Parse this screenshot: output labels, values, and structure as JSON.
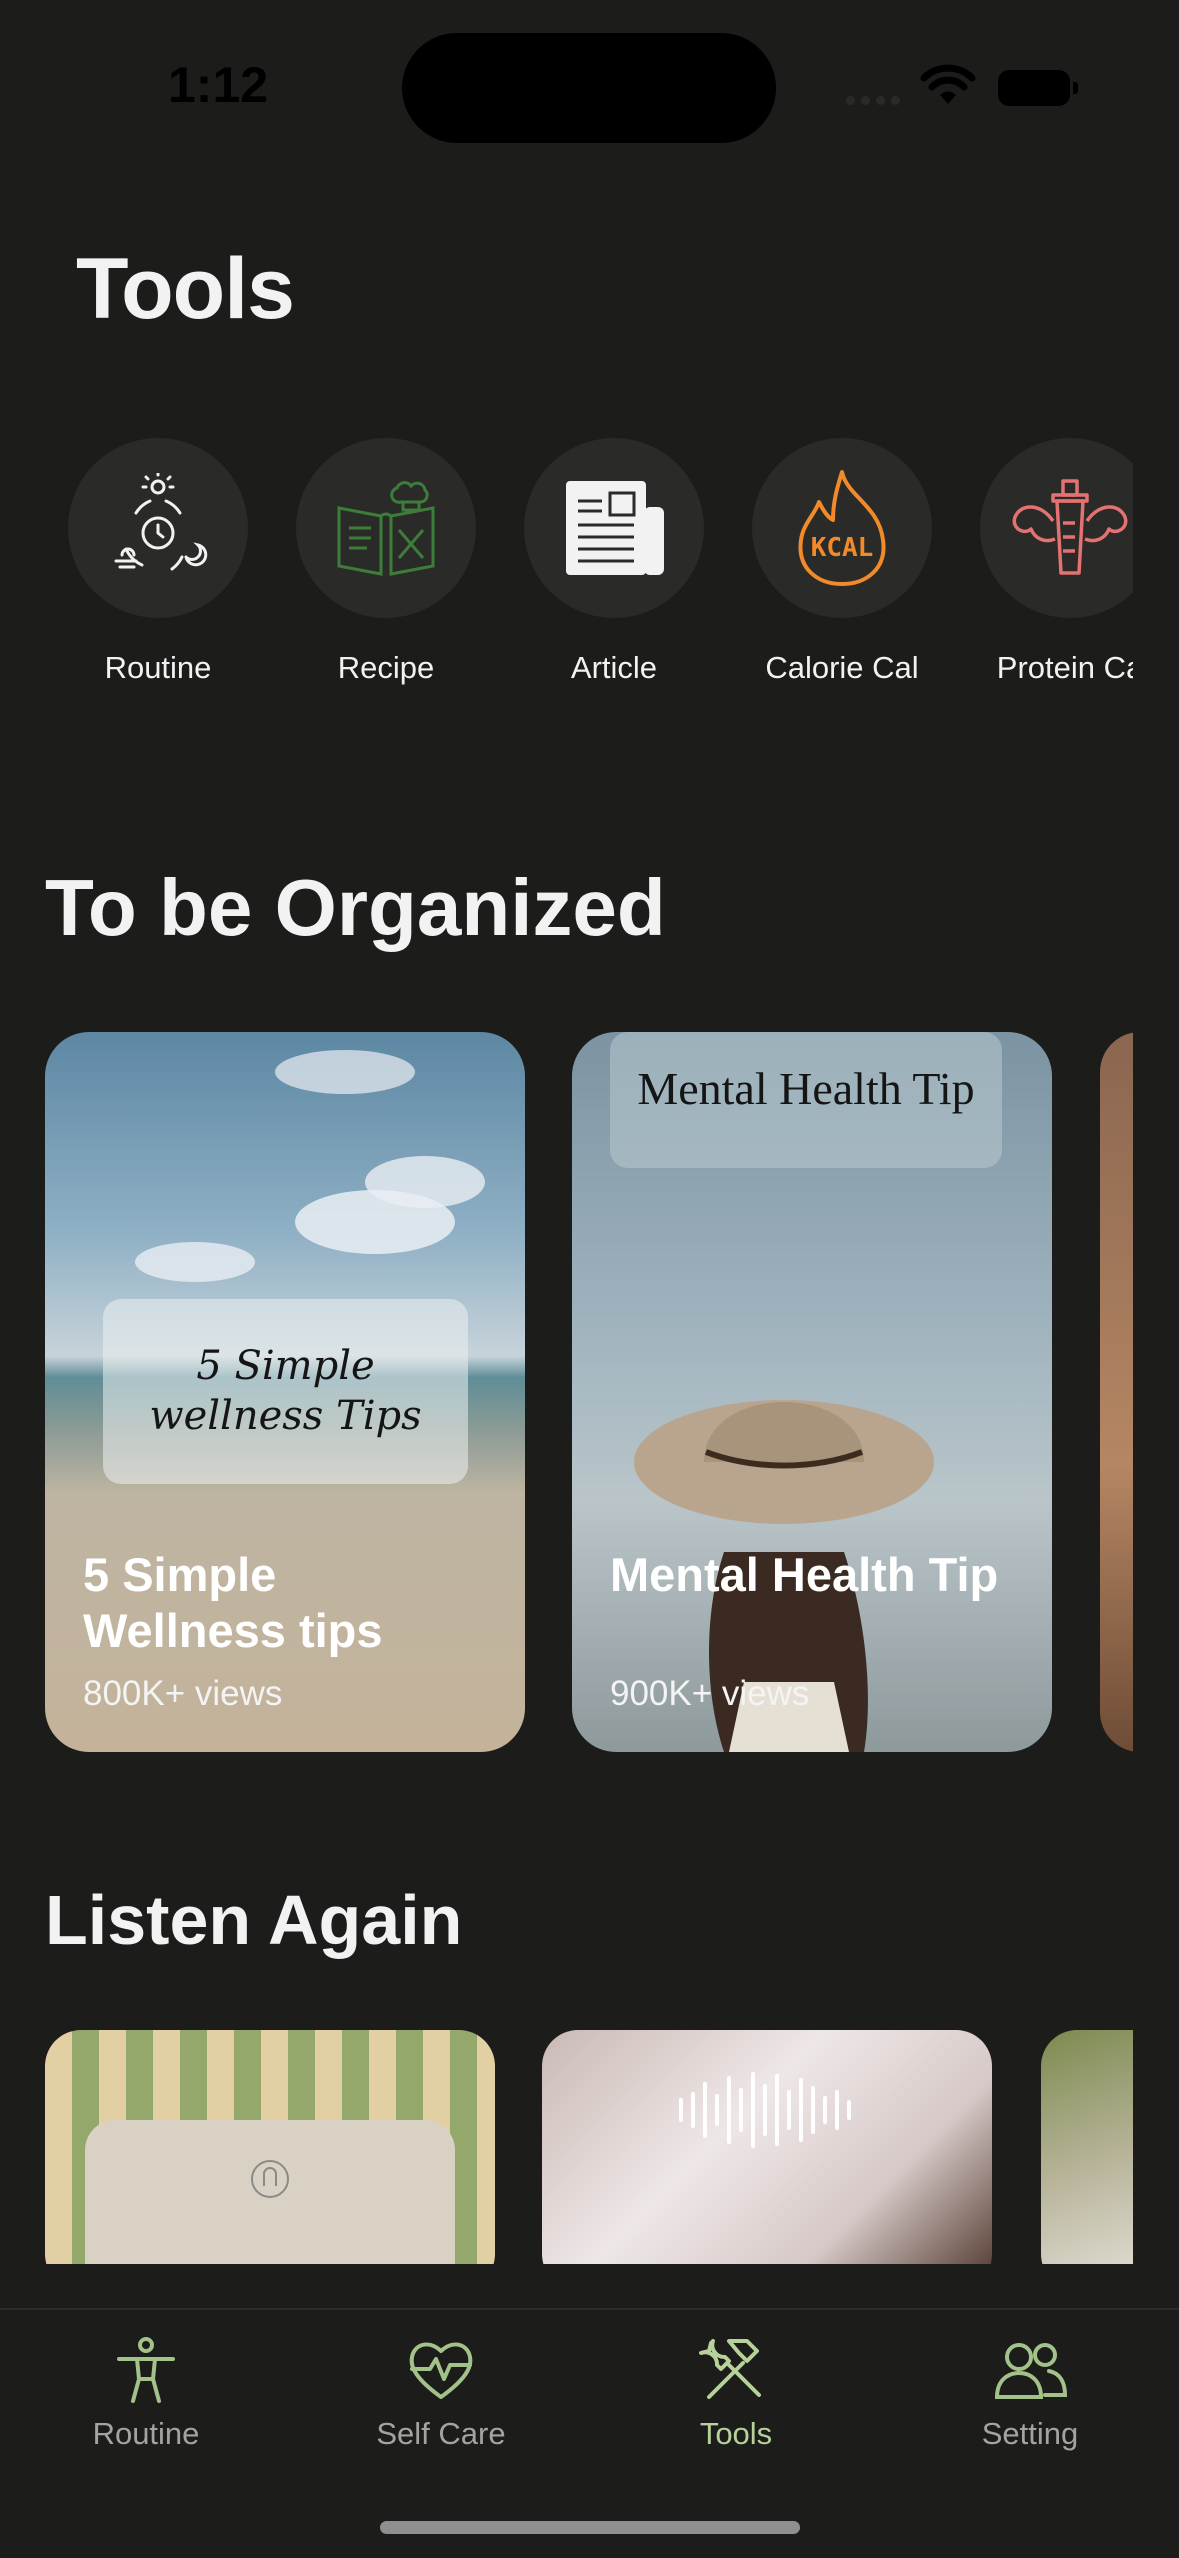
{
  "status_bar": {
    "time": "1:12"
  },
  "header": {
    "title": "Tools"
  },
  "tools": [
    {
      "label": "Routine",
      "icon": "routine-cycle-icon"
    },
    {
      "label": "Recipe",
      "icon": "recipe-book-icon"
    },
    {
      "label": "Article",
      "icon": "newspaper-icon"
    },
    {
      "label": "Calorie Cal",
      "icon": "kcal-flame-icon"
    },
    {
      "label": "Protein Ca",
      "icon": "protein-shaker-icon"
    }
  ],
  "organized": {
    "title": "To be Organized",
    "cards": [
      {
        "caption": "5 Simple wellness Tips",
        "title": "5 Simple Wellness tips",
        "views": "800K+ views"
      },
      {
        "caption": "Mental  Health Tip",
        "title": "Mental Health Tip",
        "views": "900K+ views"
      }
    ]
  },
  "listen_again": {
    "title": "Listen Again"
  },
  "tab_bar": {
    "items": [
      {
        "label": "Routine",
        "icon": "person-icon"
      },
      {
        "label": "Self Care",
        "icon": "heart-pulse-icon"
      },
      {
        "label": "Tools",
        "icon": "tools-icon",
        "active": true
      },
      {
        "label": "Setting",
        "icon": "users-icon"
      }
    ]
  },
  "colors": {
    "background": "#1c1c1a",
    "active_tab": "#b7d19a",
    "inactive_tab": "#a3a39f",
    "recipe_icon": "#3d7d3a",
    "kcal_icon": "#f08a2a",
    "protein_icon": "#e57272"
  }
}
